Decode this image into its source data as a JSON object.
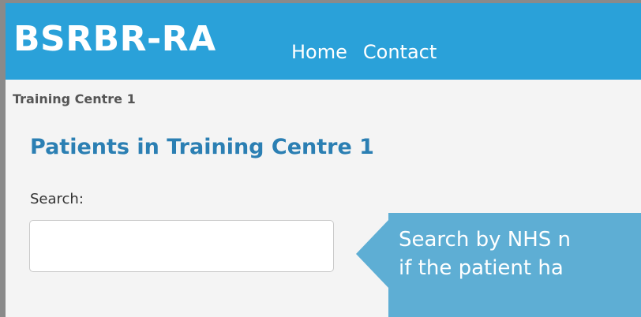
{
  "navbar": {
    "brand": "BSRBR-RA",
    "links": [
      "Home",
      "Contact"
    ]
  },
  "breadcrumb": "Training Centre 1",
  "page": {
    "title": "Patients in Training Centre 1"
  },
  "search": {
    "label": "Search:",
    "value": "",
    "placeholder": ""
  },
  "callout": {
    "line1": "Search by NHS n",
    "line2": "if the patient ha"
  },
  "colors": {
    "navbar_bg": "#2aa1d9",
    "title_color": "#2b7fb3",
    "callout_bg": "#5eaed4",
    "page_bg": "#f4f4f4"
  }
}
